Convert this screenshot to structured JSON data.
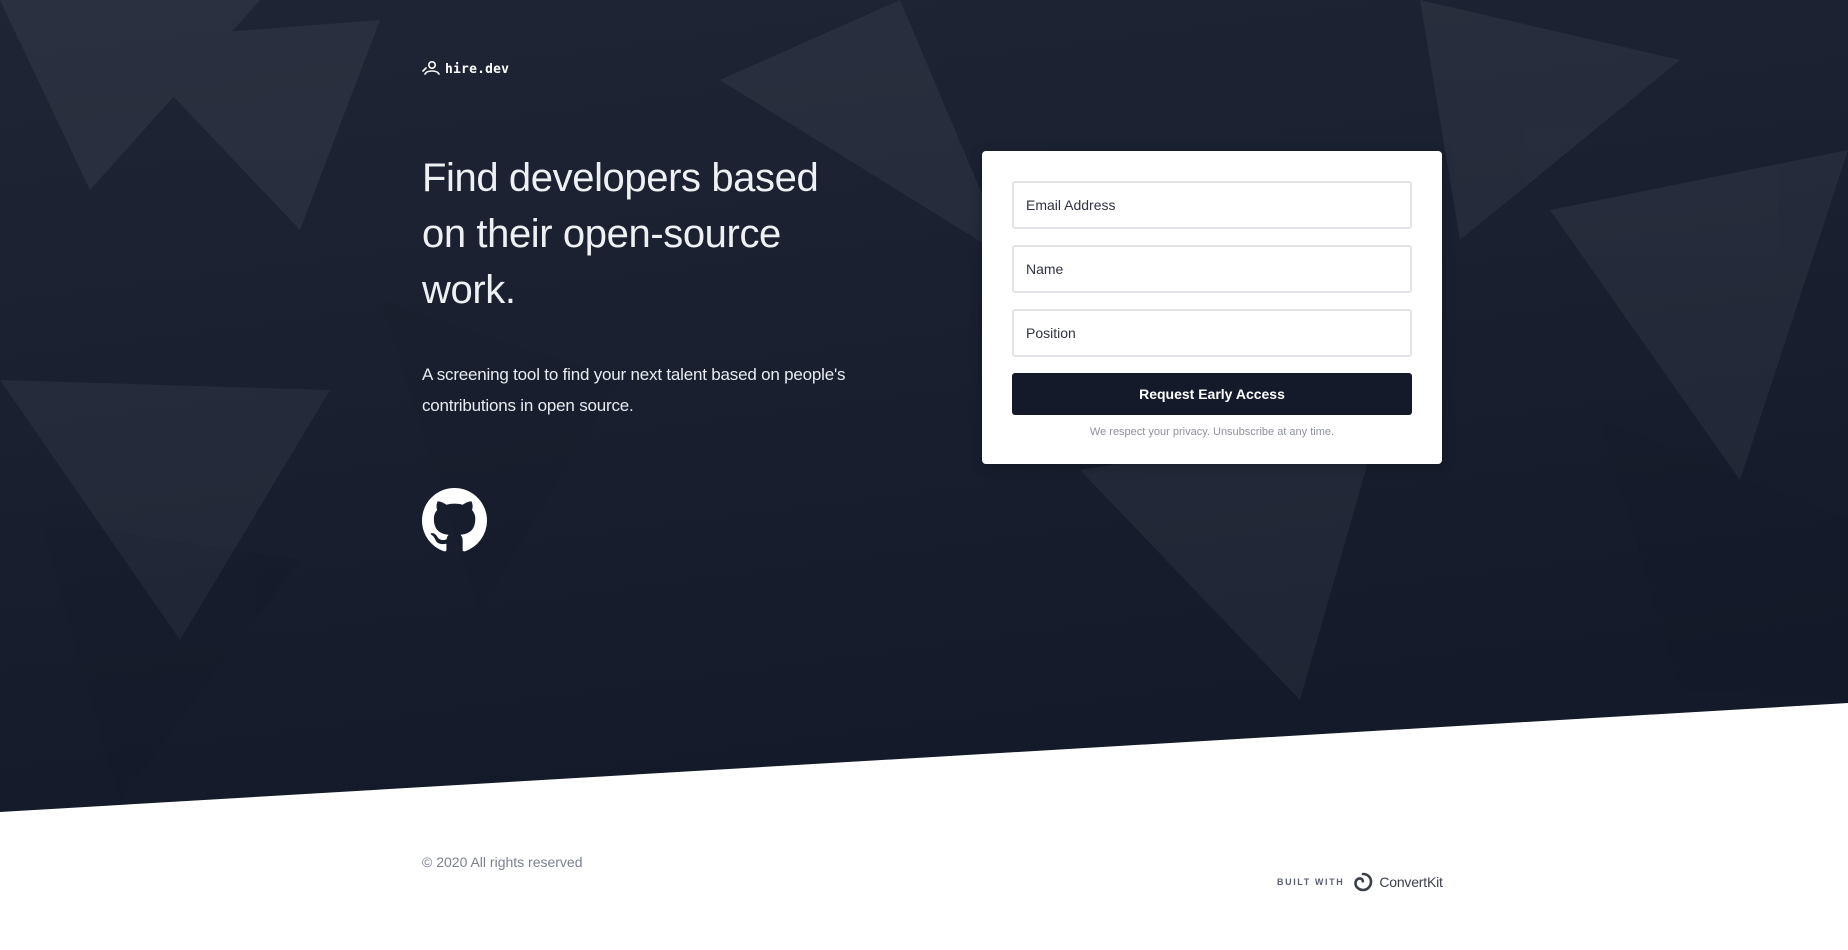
{
  "brand": {
    "name": "hire.dev",
    "logo_icon": "person-signal-icon"
  },
  "hero": {
    "headline": "Find developers based on their open-source work.",
    "subtext": "A screening tool to find your next talent based on people's contributions in open source.",
    "github_icon": "github-icon"
  },
  "form": {
    "email_placeholder": "Email Address",
    "name_placeholder": "Name",
    "position_placeholder": "Position",
    "email_value": "",
    "name_value": "",
    "position_value": "",
    "submit_label": "Request Early Access",
    "privacy_note": "We respect your privacy. Unsubscribe at any time."
  },
  "footer": {
    "copyright": "© 2020 All rights reserved",
    "built_with_label": "BUILT WITH",
    "built_with_brand": "ConvertKit",
    "built_with_icon": "convertkit-icon"
  },
  "colors": {
    "hero_background": "#1b2130",
    "button_background": "#141a29",
    "page_background": "#ffffff"
  }
}
